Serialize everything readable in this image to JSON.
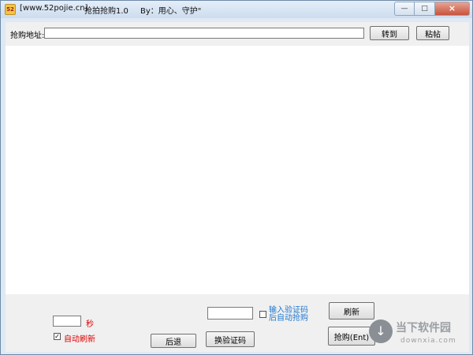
{
  "window": {
    "title_site": "[www.52pojie.cn]",
    "title_app": "抢拍抢购1.0",
    "title_author": "By：用心、守护\"",
    "controls": {
      "min": "—",
      "max": "□",
      "close": "×"
    }
  },
  "url_bar": {
    "label": "抢购地址:",
    "value": "",
    "goto_label": "转到",
    "paste_label": "粘帖"
  },
  "bottom": {
    "seconds_value": "",
    "seconds_unit": "秒",
    "auto_refresh_checked": "✓",
    "auto_refresh_label": "自动刷新",
    "back_label": "后退",
    "captcha_value": "",
    "change_captcha_label": "换验证码",
    "captcha_hint_line1": "输入验证码",
    "captcha_hint_line2": "后自动抢购",
    "refresh_label": "刷新",
    "buy_label": "抢购(Ent)"
  },
  "watermark": {
    "brand": "当下软件园",
    "domain": "downxia.com",
    "icon": "download-arrow-icon"
  },
  "colors": {
    "red_label": "#e00000",
    "blue_label": "#1e78d0"
  }
}
